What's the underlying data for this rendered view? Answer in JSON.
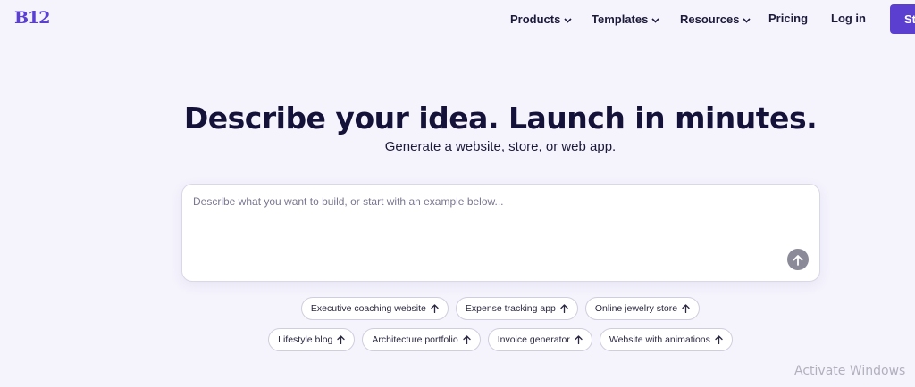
{
  "header": {
    "logo_text": "B12",
    "nav": [
      {
        "label": "Products",
        "has_dropdown": true
      },
      {
        "label": "Templates",
        "has_dropdown": true
      },
      {
        "label": "Resources",
        "has_dropdown": true
      },
      {
        "label": "Pricing",
        "has_dropdown": false
      },
      {
        "label": "Log in",
        "has_dropdown": false
      }
    ],
    "cta_label": "St"
  },
  "hero": {
    "title": "Describe your idea. Launch in minutes.",
    "subtitle": "Generate a website, store, or web app."
  },
  "prompt": {
    "placeholder": "Describe what you want to build, or start with an example below...",
    "value": "",
    "submit_icon": "arrow-up-icon"
  },
  "examples": {
    "row1": [
      "Executive coaching website",
      "Expense tracking app",
      "Online jewelry store"
    ],
    "row2": [
      "Lifestyle blog",
      "Architecture portfolio",
      "Invoice generator",
      "Website with animations"
    ]
  },
  "system": {
    "watermark": "Activate Windows"
  },
  "colors": {
    "brand": "#5b3fd0",
    "background": "#f5f4fd",
    "text": "#15123a",
    "submit_button": "#8a8a99"
  }
}
